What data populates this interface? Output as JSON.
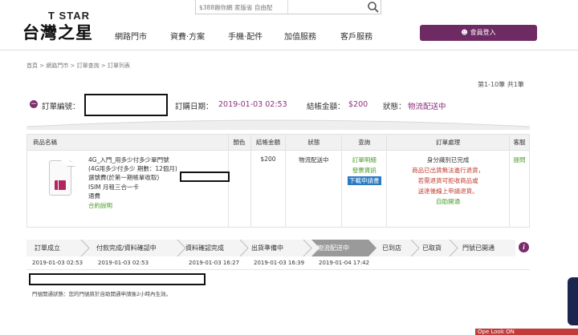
{
  "brand": {
    "top": "T STAR",
    "main": "台灣之星"
  },
  "search": {
    "placeholder": "$388飽你網 家版省 自由配"
  },
  "nav": [
    "網路門市",
    "資費‧方案",
    "手機‧配件",
    "加值服務",
    "客戶服務"
  ],
  "login": {
    "label": "會員登入"
  },
  "breadcrumb": "首頁 > 網路門市 > 訂單查詢 > 訂單列表",
  "pager": "第1-10筆 共1筆",
  "order": {
    "no_label": "訂單編號：",
    "date_label": "訂購日期：",
    "date_value": "2019-01-03 02:53",
    "amount_label": "結帳金額：",
    "amount_value": "$200",
    "status_label": "狀態：",
    "status_value": "物流配送中"
  },
  "table": {
    "headers": [
      "商品名稱",
      "顏色",
      "結帳金額",
      "狀態",
      "查詢",
      "訂單處理",
      "客服"
    ],
    "product_lines": [
      "4G_入門_用多少付多少單門號",
      "(4G用多少付多少 期數：12個月)",
      "選號費(於第一期帳單收取)",
      "ISIM 月租三合一卡",
      "通費"
    ],
    "contract_link": "合約說明",
    "amount": "$200",
    "status": "物流配送中",
    "query": [
      "訂單明細",
      "發票資訊",
      "下載申請書"
    ],
    "process": [
      "身分識別已完成",
      "商品已出貨無法進行退貨，",
      "若需退貨可拒收商品或",
      "送達後線上申請退貨。",
      "自助開通"
    ],
    "service": "提問"
  },
  "steps": [
    {
      "label": "訂單成立",
      "date": "2019-01-03 02:53"
    },
    {
      "label": "付款完成/資料確認中",
      "date": "2019-01-03 02:53"
    },
    {
      "label": "資料確認完成",
      "date": "2019-01-03 16:27"
    },
    {
      "label": "出貨準備中",
      "date": "2019-01-03 16:39"
    },
    {
      "label": "物流配送中",
      "date": "2019-01-04 17:42"
    },
    {
      "label": "已到店",
      "date": ""
    },
    {
      "label": "已取貨",
      "date": ""
    },
    {
      "label": "門號已開通",
      "date": ""
    }
  ],
  "status_note": "門號開通狀態：您的門號將於自助開通申請後2小時內生效。",
  "corner_text": "Ope Look ON",
  "colors": {
    "brand_purple": "#6e2a63",
    "accent_purple": "#8a2f7d",
    "active_step": "#9a9a9a",
    "green": "#4a9a2a",
    "red": "#c0392b"
  },
  "icons": [
    "search-icon",
    "user-icon",
    "minus-circle-icon",
    "info-icon",
    "sim-card-icon"
  ]
}
